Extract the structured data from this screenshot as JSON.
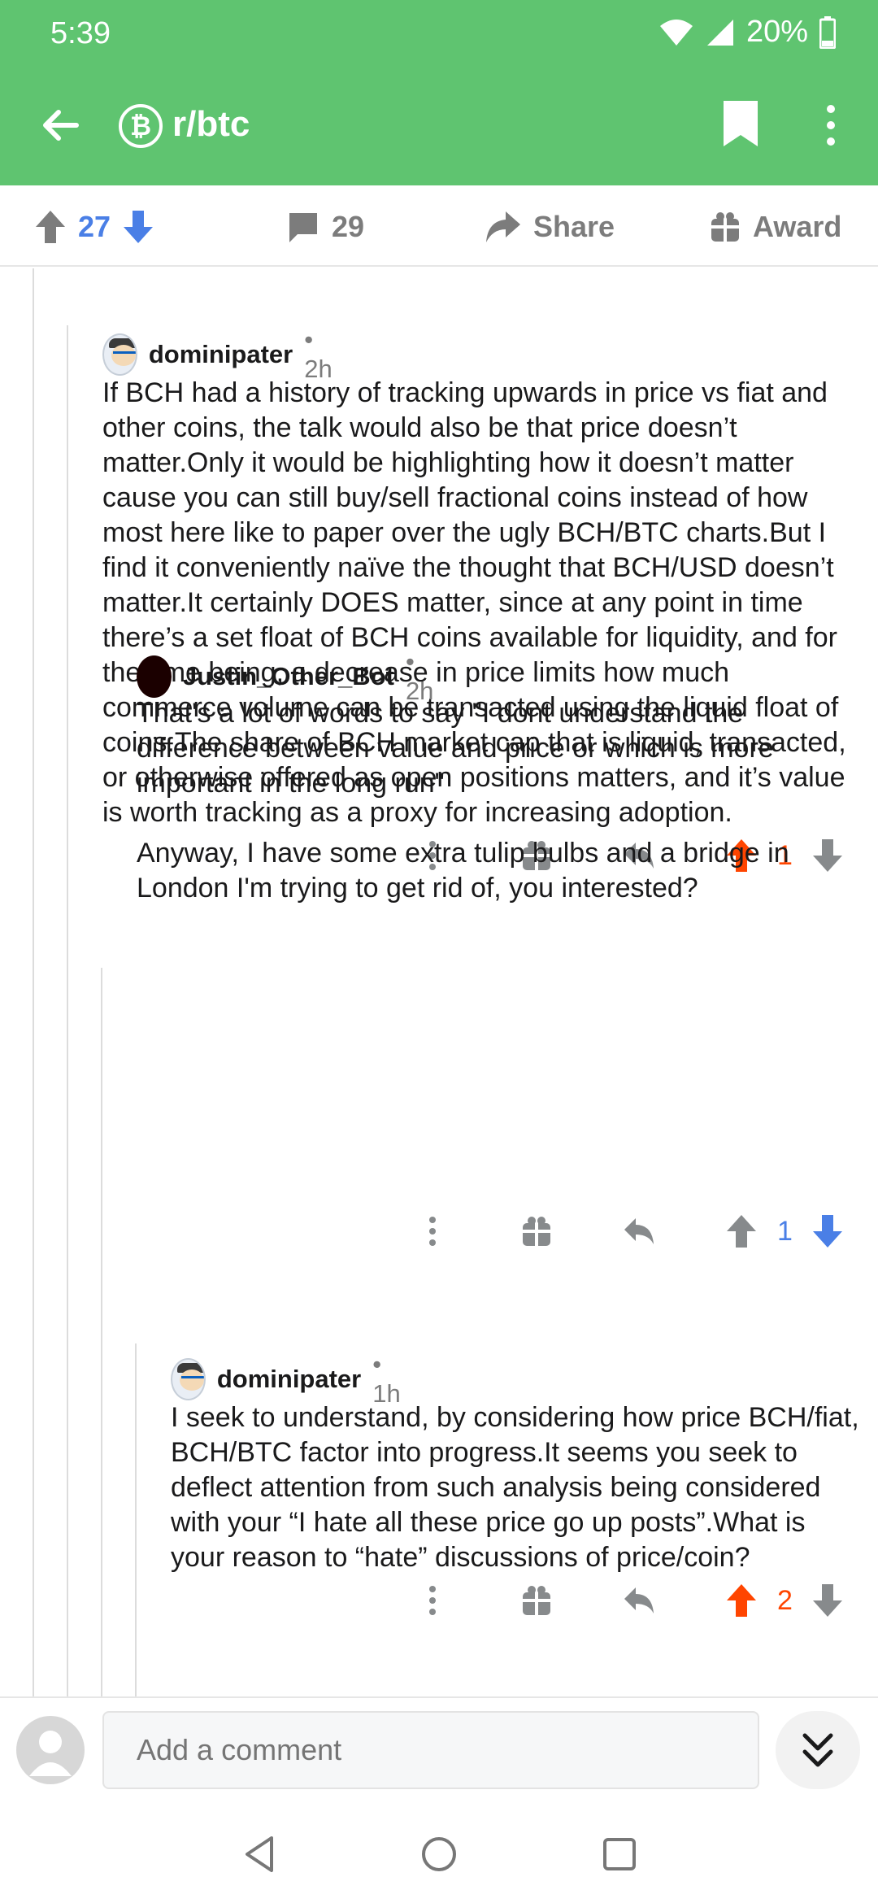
{
  "status_bar": {
    "time": "5:39",
    "battery": "20%"
  },
  "app_bar": {
    "subreddit_icon": "₿",
    "subreddit": "r/btc"
  },
  "post_actions": {
    "votes": "27",
    "comments": "29",
    "share_label": "Share",
    "award_label": "Award"
  },
  "comments": [
    {
      "author": "dominipater",
      "age": "• 2h",
      "paragraphs": [
        "If BCH had a history of tracking upwards in price vs fiat and other coins, the talk would also be that price doesn’t matter.Only it would be highlighting how it doesn’t matter cause you can still buy/sell fractional coins instead of how most here like to paper over the ugly BCH/BTC charts.But I find it conveniently naïve the thought that BCH/USD doesn’t matter.It certainly DOES matter, since at any point in time there’s a set float of BCH coins available for liquidity, and for the time being, a decrease in price limits how much commerce volume can be transacted using the liquid float of coins.The share of BCH market cap that is liquid, transacted, or otherwise offered as open positions matters, and it’s value is worth tracking as a proxy for increasing adoption."
      ],
      "score": "1",
      "vote_state": "upvoted"
    },
    {
      "author": "Justin_Other_Bot",
      "age": "• 2h",
      "paragraphs": [
        "That's a lot of words to say \"I dont understand the difference between value and price or which is more important in the long run\"",
        "Anyway, I have some extra tulip bulbs and a bridge in London I'm trying to get rid of, you interested?"
      ],
      "score": "1",
      "vote_state": "downvoted"
    },
    {
      "author": "dominipater",
      "age": "• 1h",
      "paragraphs": [
        "I seek to understand, by considering how price BCH/fiat, BCH/BTC factor into progress.It seems you seek to deflect attention from such analysis being considered with your “I hate all these price go up posts”.What is your reason to “hate” discussions of price/coin?"
      ],
      "score": "2",
      "vote_state": "upvoted"
    }
  ],
  "composer": {
    "placeholder": "Add a comment"
  },
  "colors": {
    "brand_green": "#5fc470",
    "upvote_orange": "#ff4500",
    "downvote_blue": "#4a7fe6",
    "icon_gray": "#878a8c"
  },
  "icons": [
    "back-arrow-icon",
    "bitcoin-icon",
    "bookmark-icon",
    "more-vertical-icon",
    "upvote-icon",
    "downvote-icon",
    "comment-icon",
    "share-icon",
    "gift-icon",
    "reply-icon",
    "collapse-icon",
    "nav-back-icon",
    "nav-home-icon",
    "nav-recents-icon"
  ]
}
